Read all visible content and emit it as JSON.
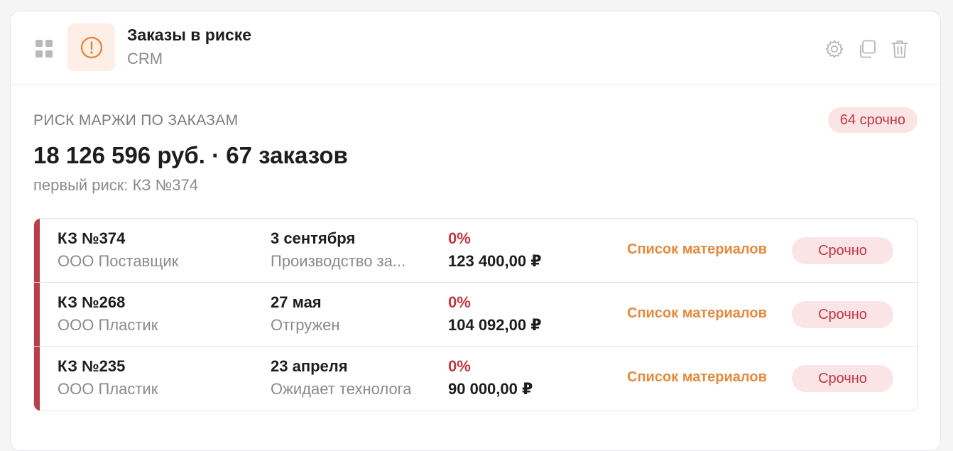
{
  "widget": {
    "title": "Заказы в риске",
    "subtitle": "CRM",
    "icon": "alert-circle-icon",
    "accent_color": "#e6893c"
  },
  "header_actions": [
    {
      "name": "settings-icon"
    },
    {
      "name": "duplicate-icon"
    },
    {
      "name": "trash-icon"
    }
  ],
  "section": {
    "label": "РИСК МАРЖИ ПО ЗАКАЗАМ",
    "urgent_badge": "64 срочно",
    "summary": "18 126 596 руб. · 67 заказов",
    "first_risk": "первый риск: КЗ №374"
  },
  "colors": {
    "danger": "#c0383f",
    "danger_bg": "#fbe4e5",
    "link": "#e6893c",
    "row_accent": "#b8404a"
  },
  "orders": [
    {
      "id": "КЗ №374",
      "company": "ООО Поставщик",
      "date": "3 сентября",
      "status": "Производство за...",
      "percent": "0%",
      "amount": "123 400,00 ₽",
      "link": "Список материалов",
      "badge": "Срочно"
    },
    {
      "id": "КЗ №268",
      "company": "ООО Пластик",
      "date": "27 мая",
      "status": "Отгружен",
      "percent": "0%",
      "amount": "104 092,00 ₽",
      "link": "Список материалов",
      "badge": "Срочно"
    },
    {
      "id": "КЗ №235",
      "company": "ООО Пластик",
      "date": "23 апреля",
      "status": "Ожидает технолога",
      "percent": "0%",
      "amount": "90 000,00 ₽",
      "link": "Список материалов",
      "badge": "Срочно"
    }
  ]
}
